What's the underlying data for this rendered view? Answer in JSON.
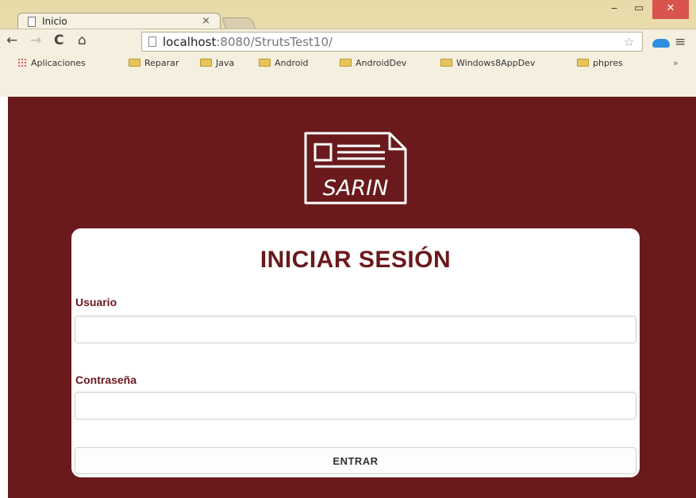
{
  "browser": {
    "tab_title": "Inicio",
    "tab_close": "×",
    "url_host": "localhost",
    "url_rest": ":8080/StrutsTest10/",
    "window_controls": {
      "minimize": "‒",
      "maximize": "▭",
      "close": "✕"
    },
    "nav": {
      "back": "←",
      "forward": "→",
      "reload": "C",
      "home": "⌂",
      "star": "☆",
      "menu": "≡"
    },
    "bookmarks": [
      {
        "label": "Aplicaciones",
        "icon": "apps-grid-icon"
      },
      {
        "label": "Reparar",
        "icon": "folder-icon"
      },
      {
        "label": "Java",
        "icon": "folder-icon"
      },
      {
        "label": "Android",
        "icon": "folder-icon"
      },
      {
        "label": "AndroidDev",
        "icon": "folder-icon"
      },
      {
        "label": "Windows8AppDev",
        "icon": "folder-icon"
      },
      {
        "label": "phpres",
        "icon": "folder-icon"
      }
    ],
    "bookmarks_more": "»"
  },
  "logo": {
    "text": "SARIN"
  },
  "login": {
    "title": "INICIAR SESIÓN",
    "username_label": "Usuario",
    "username_value": "",
    "password_label": "Contraseña",
    "password_value": "",
    "submit_label": "ENTRAR"
  },
  "colors": {
    "page_background": "#6a1a1c",
    "accent": "#6a1a1c",
    "card": "#ffffff",
    "close_button": "#d9544c"
  }
}
